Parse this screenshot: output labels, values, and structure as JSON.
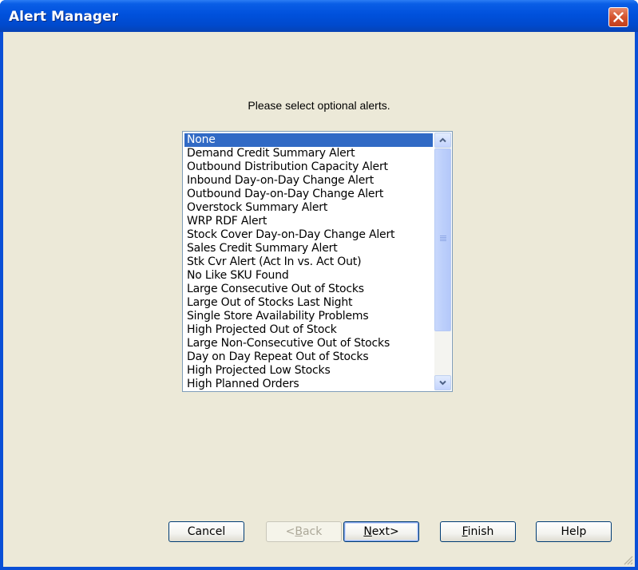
{
  "window": {
    "title": "Alert Manager"
  },
  "prompt": "Please select optional alerts.",
  "alerts": [
    "None",
    "Demand Credit Summary Alert",
    "Outbound Distribution Capacity Alert",
    "Inbound Day-on-Day Change Alert",
    "Outbound Day-on-Day Change Alert",
    "Overstock Summary Alert",
    "WRP RDF Alert",
    "Stock Cover Day-on-Day Change Alert",
    "Sales Credit Summary Alert",
    "Stk Cvr Alert (Act In vs. Act Out)",
    "No Like SKU Found",
    "Large Consecutive Out of Stocks",
    "Large Out of Stocks Last Night",
    "Single Store Availability Problems",
    "High Projected Out of Stock",
    "Large Non-Consecutive Out of Stocks",
    "Day on Day Repeat Out of Stocks",
    "High Projected Low Stocks",
    "High Planned Orders"
  ],
  "selected_alert": "None",
  "buttons": {
    "cancel": "Cancel",
    "back_mnemonic": "B",
    "back_pre": "<",
    "back_post": "ack",
    "next_mnemonic": "N",
    "next_post": "ext>",
    "finish_mnemonic": "F",
    "finish_post": "inish",
    "help": "Help"
  },
  "colors": {
    "selection": "#316ac5",
    "dialog_bg": "#ece9d8",
    "titlebar": "#0051dc",
    "close_button": "#d4532e"
  },
  "icons": {
    "close": "close-icon",
    "scroll_up": "arrow-up-icon",
    "scroll_down": "arrow-down-icon",
    "resize": "resize-grip-icon"
  }
}
